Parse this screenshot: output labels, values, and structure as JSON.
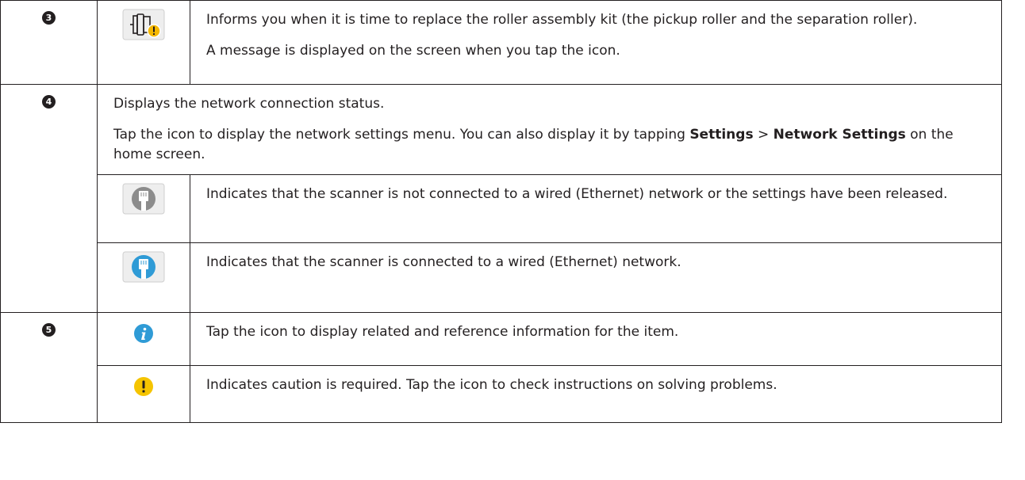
{
  "rows": {
    "r3": {
      "number": "3",
      "icon": "roller-warning-icon",
      "p1": "Informs you when it is time to replace the roller assembly kit (the pickup roller and the separation roller).",
      "p2": "A message is displayed on the screen when you tap the icon."
    },
    "r4": {
      "number": "4",
      "p1": "Displays the network connection status.",
      "p2_a": "Tap the icon to display the network settings menu. You can also display it by tapping ",
      "p2_b": "Settings",
      "p2_c": " > ",
      "p2_d": "Network Settings",
      "p2_e": " on the home screen.",
      "sub": [
        {
          "icon": "ethernet-disconnected-icon",
          "text": "Indicates that the scanner is not connected to a wired (Ethernet) network or the settings have been released."
        },
        {
          "icon": "ethernet-connected-icon",
          "text": "Indicates that the scanner is connected to a wired (Ethernet) network."
        }
      ]
    },
    "r5": {
      "number": "5",
      "sub": [
        {
          "icon": "info-icon",
          "text": "Tap the icon to display related and reference information for the item."
        },
        {
          "icon": "caution-icon",
          "text": "Indicates caution is required. Tap the icon to check instructions on solving problems."
        }
      ]
    }
  },
  "colors": {
    "info_blue": "#2f9bd6",
    "caution_yellow": "#f5c400",
    "icon_gray": "#8c8c8c"
  }
}
